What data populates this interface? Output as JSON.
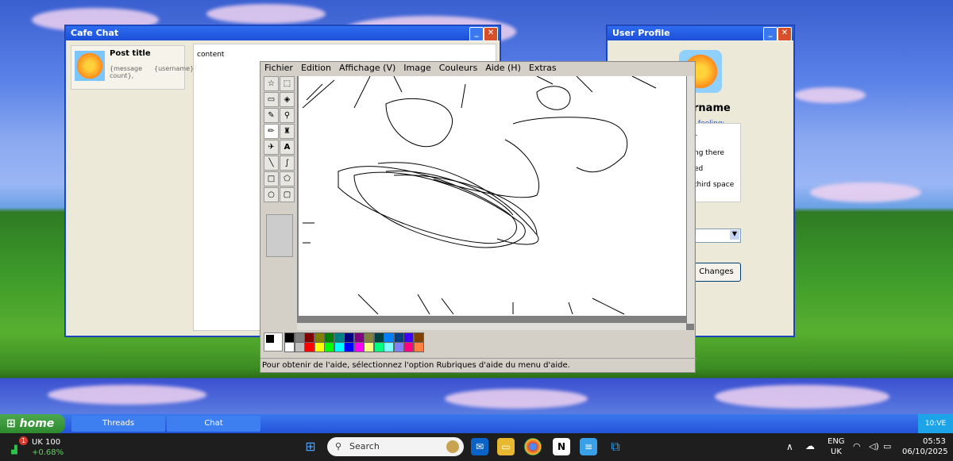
{
  "cafe_chat": {
    "title": "Cafe Chat",
    "post_title": "Post title",
    "meta1": "{message count},",
    "meta2": "{username}",
    "content": "content"
  },
  "user_profile": {
    "title": "User Profile",
    "username_partial": "rname",
    "feeling_label": "/ feeling:",
    "options": [
      "r",
      "ng there",
      "ed",
      "third space"
    ],
    "save_button": "Changes"
  },
  "paint": {
    "menu": [
      "Fichier",
      "Edition",
      "Affichage (V)",
      "Image",
      "Couleurs",
      "Aide (H)",
      "Extras"
    ],
    "status": "Pour obtenir de l'aide, sélectionnez l'option Rubriques d'aide du menu d'aide.",
    "palette_top": [
      "#000000",
      "#808080",
      "#800000",
      "#808000",
      "#008000",
      "#008080",
      "#000080",
      "#800080",
      "#808040",
      "#004040",
      "#0080ff",
      "#004080",
      "#4000ff",
      "#804000"
    ],
    "palette_bottom": [
      "#ffffff",
      "#c0c0c0",
      "#ff0000",
      "#ffff00",
      "#00ff00",
      "#00ffff",
      "#0000ff",
      "#ff00ff",
      "#ffff80",
      "#00ff80",
      "#80ffff",
      "#8080ff",
      "#ff0080",
      "#ff8040"
    ]
  },
  "xp_taskbar": {
    "start": "home",
    "tasks": [
      "Threads",
      "Chat"
    ],
    "clock": "10:VE"
  },
  "win11": {
    "ticker_name": "UK 100",
    "ticker_change": "+0.68%",
    "badge": "1",
    "search": "Search",
    "lang1": "ENG",
    "lang2": "UK",
    "time": "05:53",
    "date": "06/10/2025"
  }
}
